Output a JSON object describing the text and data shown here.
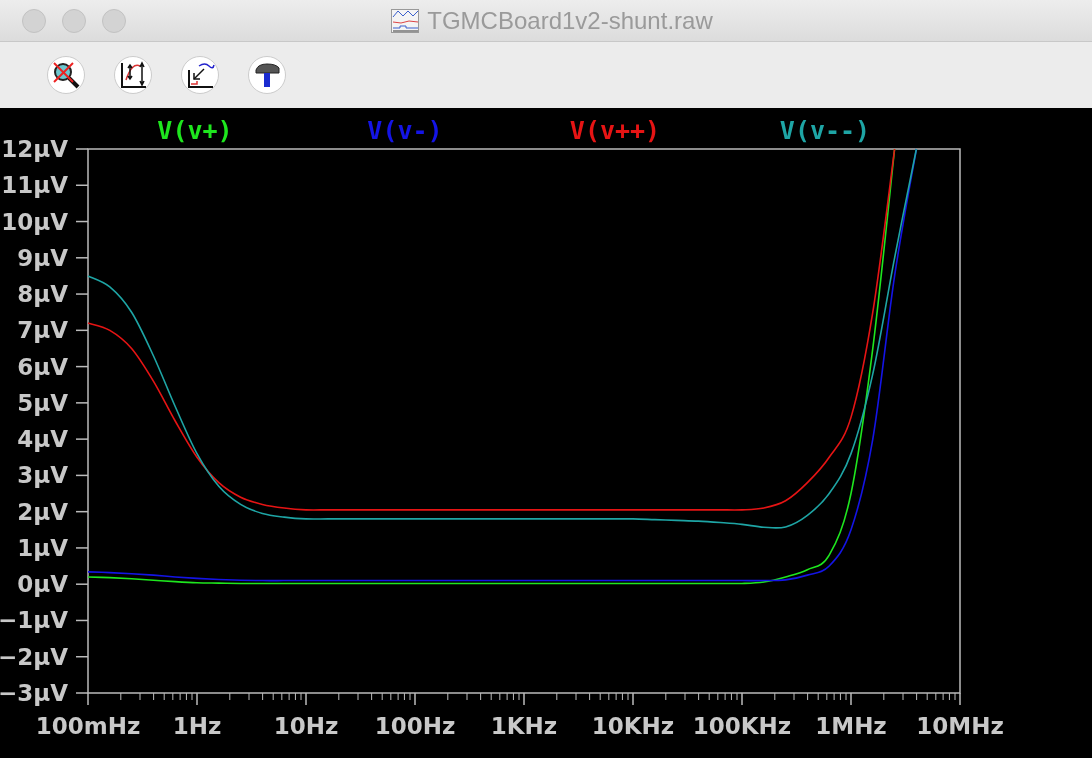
{
  "window": {
    "title": "TGMCBoard1v2-shunt.raw"
  },
  "plot": {
    "chart_data": {
      "type": "line",
      "categories": [
        "100mHz",
        null,
        null,
        null,
        null,
        "1Hz",
        null,
        null,
        null,
        null,
        "10Hz",
        null,
        null,
        null,
        null,
        "100Hz",
        null,
        null,
        null,
        null,
        "1KHz",
        null,
        null,
        null,
        null,
        "10KHz",
        null,
        null,
        null,
        null,
        "100KHz",
        null,
        null,
        null,
        null,
        "1MHz",
        null,
        null,
        null,
        null,
        "10MHz"
      ],
      "series": [
        {
          "name": "V(v+)",
          "color": "#1ee61e",
          "values": [
            0.2,
            0.18,
            0.15,
            0.11,
            0.07,
            0.04,
            0.03,
            0.02,
            0.02,
            0.02,
            0.02,
            0.02,
            0.02,
            0.02,
            0.02,
            0.02,
            0.02,
            0.02,
            0.02,
            0.02,
            0.02,
            0.02,
            0.02,
            0.02,
            0.02,
            0.02,
            0.02,
            0.02,
            0.02,
            0.02,
            0.02,
            0.06,
            0.2,
            0.4,
            0.8,
            2.5,
            6.5,
            12,
            null,
            null,
            null
          ]
        },
        {
          "name": "V(v-)",
          "color": "#1414e6",
          "values": [
            0.34,
            0.32,
            0.29,
            0.25,
            0.2,
            0.16,
            0.13,
            0.11,
            0.1,
            0.1,
            0.1,
            0.1,
            0.1,
            0.1,
            0.1,
            0.1,
            0.1,
            0.1,
            0.1,
            0.1,
            0.1,
            0.1,
            0.1,
            0.1,
            0.1,
            0.1,
            0.1,
            0.1,
            0.1,
            0.1,
            0.1,
            0.1,
            0.12,
            0.25,
            0.5,
            1.5,
            4,
            8.5,
            12,
            null,
            null
          ]
        },
        {
          "name": "V(v++)",
          "color": "#e61414",
          "values": [
            7.2,
            7.0,
            6.5,
            5.6,
            4.5,
            3.5,
            2.8,
            2.4,
            2.2,
            2.1,
            2.05,
            2.05,
            2.05,
            2.05,
            2.05,
            2.05,
            2.05,
            2.05,
            2.05,
            2.05,
            2.05,
            2.05,
            2.05,
            2.05,
            2.05,
            2.05,
            2.05,
            2.05,
            2.05,
            2.05,
            2.05,
            2.1,
            2.3,
            2.8,
            3.5,
            4.6,
            7.5,
            12,
            null,
            null,
            null
          ]
        },
        {
          "name": "V(v--)",
          "color": "#1ea5a5",
          "values": [
            8.5,
            8.2,
            7.5,
            6.3,
            4.9,
            3.6,
            2.7,
            2.2,
            1.95,
            1.85,
            1.8,
            1.8,
            1.8,
            1.8,
            1.8,
            1.8,
            1.8,
            1.8,
            1.8,
            1.8,
            1.8,
            1.8,
            1.8,
            1.8,
            1.8,
            1.8,
            1.78,
            1.76,
            1.74,
            1.7,
            1.65,
            1.57,
            1.58,
            1.9,
            2.5,
            3.6,
            5.8,
            9,
            12,
            null,
            null
          ]
        }
      ],
      "ylim": [
        -3,
        12
      ],
      "yticks": [
        {
          "value": 12,
          "label": "12µV"
        },
        {
          "value": 11,
          "label": "11µV"
        },
        {
          "value": 10,
          "label": "10µV"
        },
        {
          "value": 9,
          "label": "9µV"
        },
        {
          "value": 8,
          "label": "8µV"
        },
        {
          "value": 7,
          "label": "7µV"
        },
        {
          "value": 6,
          "label": "6µV"
        },
        {
          "value": 5,
          "label": "5µV"
        },
        {
          "value": 4,
          "label": "4µV"
        },
        {
          "value": 3,
          "label": "3µV"
        },
        {
          "value": 2,
          "label": "2µV"
        },
        {
          "value": 1,
          "label": "1µV"
        },
        {
          "value": 0,
          "label": "0µV"
        },
        {
          "value": -1,
          "label": "−1µV"
        },
        {
          "value": -2,
          "label": "−2µV"
        },
        {
          "value": -3,
          "label": "−3µV"
        }
      ]
    }
  }
}
